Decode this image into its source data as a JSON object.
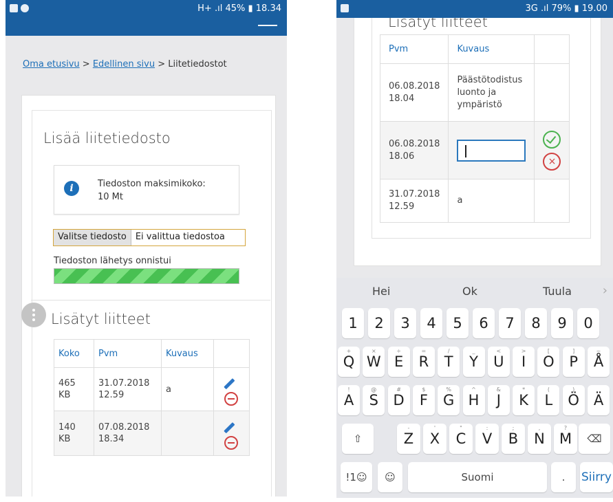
{
  "left": {
    "status": {
      "right": "45% ▮ 18.34",
      "signal": "H+ .ıl"
    },
    "breadcrumb": {
      "home": "Oma etusivu",
      "sep1": " > ",
      "prev": "Edellinen sivu",
      "sep2": " > ",
      "current": "Liitetiedostot"
    },
    "add_title": "Lisää liitetiedosto",
    "info": {
      "line1": "Tiedoston maksimikoko:",
      "line2": "10 Mt"
    },
    "file_button": "Valitse tiedosto",
    "file_name": "Ei valittua tiedostoa",
    "upload_status": "Tiedoston lähetys onnistui",
    "upload_progress": 1.0,
    "list_title": "Lisätyt liitteet",
    "table": {
      "headers": [
        "Koko",
        "Pvm",
        "Kuvaus",
        ""
      ],
      "rows": [
        {
          "size1": "465",
          "size2": "KB",
          "date1": "31.07.2018",
          "date2": "12.59",
          "desc": "a"
        },
        {
          "size1": "140",
          "size2": "KB",
          "date1": "07.08.2018",
          "date2": "18.34",
          "desc": ""
        }
      ]
    }
  },
  "right": {
    "status": {
      "right": "79% ▮ 19.00",
      "signal": "3G .ıl"
    },
    "heading": "Lisätyt liitteet",
    "table": {
      "headers": [
        "Pvm",
        "Kuvaus",
        ""
      ],
      "rows": [
        {
          "date1": "06.08.2018",
          "date2": "18.04",
          "desc1": "Päästötodistus",
          "desc2": "luonto ja",
          "desc3": "ympäristö"
        },
        {
          "date1": "06.08.2018",
          "date2": "18.06",
          "input_value": ""
        },
        {
          "date1": "31.07.2018",
          "date2": "12.59",
          "desc1": "a"
        }
      ]
    },
    "keyboard": {
      "suggestions": [
        "Hei",
        "Ok",
        "Tuula"
      ],
      "numbers": [
        "1",
        "2",
        "3",
        "4",
        "5",
        "6",
        "7",
        "8",
        "9",
        "0"
      ],
      "row1": [
        "Q",
        "W",
        "E",
        "R",
        "T",
        "Y",
        "U",
        "I",
        "O",
        "P",
        "Å"
      ],
      "row1_sub": [
        "+",
        "×",
        "÷",
        "=",
        "/",
        "_",
        "<",
        ">",
        "[",
        "]",
        "~"
      ],
      "row2": [
        "A",
        "S",
        "D",
        "F",
        "G",
        "H",
        "J",
        "K",
        "L",
        "Ö",
        "Ä"
      ],
      "row2_sub": [
        "!",
        "@",
        "#",
        "$",
        "%",
        "^",
        "&",
        "*",
        "(",
        ")",
        ""
      ],
      "row3": [
        "Z",
        "X",
        "C",
        "V",
        "B",
        "N",
        "M"
      ],
      "row3_sub": [
        "-",
        "'",
        "\"",
        ":",
        ";",
        ",",
        "?"
      ],
      "symbols": "!1☺",
      "space": "Suomi",
      "period": ".",
      "go": "Siirry"
    }
  }
}
